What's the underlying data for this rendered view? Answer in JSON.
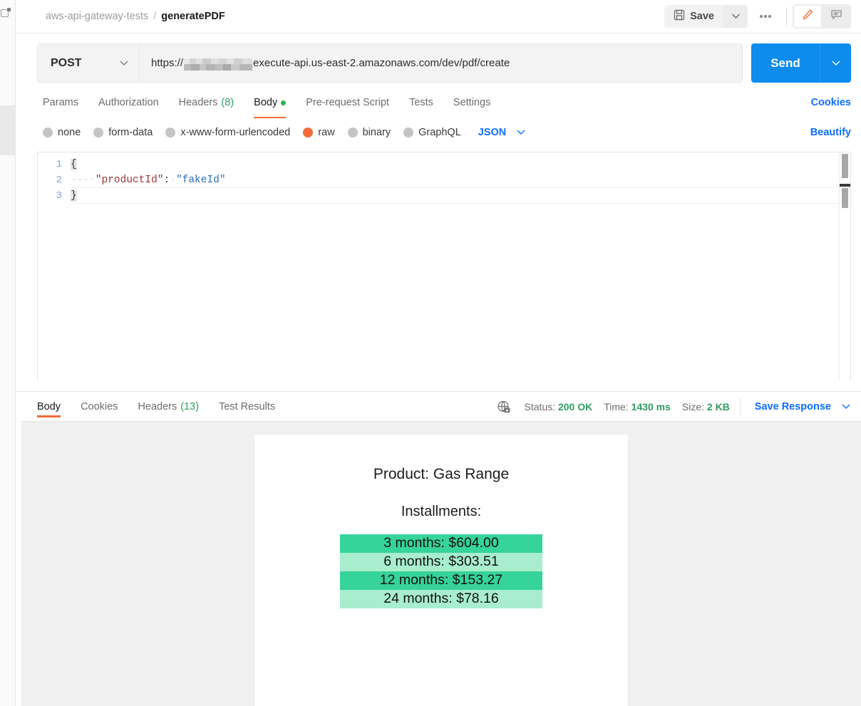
{
  "header": {
    "breadcrumb": {
      "collection": "aws-api-gateway-tests",
      "separator": "/",
      "request": "generatePDF"
    },
    "save_label": "Save",
    "save_icon": "floppy-disk-icon",
    "save_caret_icon": "chevron-down-icon",
    "more_icon": "more-horizontal-icon",
    "edit_icon": "pencil-icon",
    "comment_icon": "comment-icon",
    "accent_orange": "#f26b3a"
  },
  "request": {
    "method": "POST",
    "method_caret_icon": "chevron-down-icon",
    "url_prefix": "https://",
    "url_redacted": true,
    "url_suffix": "execute-api.us-east-2.amazonaws.com/dev/pdf/create",
    "send_label": "Send",
    "send_caret_icon": "chevron-down-icon",
    "send_color": "#0d8ced",
    "tabs": [
      {
        "label": "Params",
        "count": null,
        "active": false,
        "dot": false
      },
      {
        "label": "Authorization",
        "count": null,
        "active": false,
        "dot": false
      },
      {
        "label": "Headers",
        "count": "(8)",
        "active": false,
        "dot": false
      },
      {
        "label": "Body",
        "count": null,
        "active": true,
        "dot": true
      },
      {
        "label": "Pre-request Script",
        "count": null,
        "active": false,
        "dot": false
      },
      {
        "label": "Tests",
        "count": null,
        "active": false,
        "dot": false
      },
      {
        "label": "Settings",
        "count": null,
        "active": false,
        "dot": false
      }
    ],
    "cookies_label": "Cookies",
    "beautify_label": "Beautify",
    "body_types": [
      {
        "label": "none",
        "checked": false
      },
      {
        "label": "form-data",
        "checked": false
      },
      {
        "label": "x-www-form-urlencoded",
        "checked": false
      },
      {
        "label": "raw",
        "checked": true
      },
      {
        "label": "binary",
        "checked": false
      },
      {
        "label": "GraphQL",
        "checked": false
      }
    ],
    "raw_format": "JSON",
    "raw_format_caret_icon": "chevron-down-icon",
    "editor": {
      "line_numbers": [
        "1",
        "2",
        "3"
      ],
      "lines": [
        {
          "text": "{",
          "type": "brace"
        },
        {
          "indent": "····",
          "key": "\"productId\"",
          "colon": ":",
          "value": "\"fakeId\"",
          "type": "pair"
        },
        {
          "text": "}",
          "type": "brace"
        }
      ]
    }
  },
  "response": {
    "tabs": [
      {
        "label": "Body",
        "count": null,
        "active": true
      },
      {
        "label": "Cookies",
        "count": null,
        "active": false
      },
      {
        "label": "Headers",
        "count": "(13)",
        "active": false
      },
      {
        "label": "Test Results",
        "count": null,
        "active": false
      }
    ],
    "network_icon": "globe-lock-icon",
    "status_label": "Status:",
    "status_value": "200 OK",
    "time_label": "Time:",
    "time_value": "1430 ms",
    "size_label": "Size:",
    "size_value": "2 KB",
    "save_response_label": "Save Response",
    "save_response_caret_icon": "chevron-down-icon",
    "status_color": "#2f9e63"
  },
  "pdf": {
    "title": "Product: Gas Range",
    "subtitle": "Installments:",
    "colors": {
      "dark_row": "#36d39b",
      "light_row": "#a8eece"
    },
    "installments": [
      {
        "text": "3 months: $604.00",
        "shade": "dark"
      },
      {
        "text": "6 months: $303.51",
        "shade": "light"
      },
      {
        "text": "12 months: $153.27",
        "shade": "dark"
      },
      {
        "text": "24 months: $78.16",
        "shade": "light"
      }
    ]
  }
}
